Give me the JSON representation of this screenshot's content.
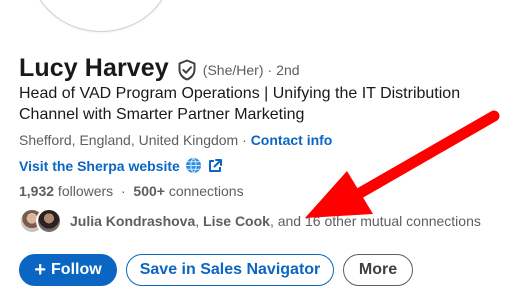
{
  "profile": {
    "name": "Lucy Harvey",
    "pronouns": "(She/Her)",
    "separator": "·",
    "degree": "2nd",
    "headline": "Head of VAD Program Operations | Unifying the IT Distribution Channel with Smarter Partner Marketing",
    "location": "Shefford, England, United Kingdom",
    "location_separator": " · ",
    "contact_link": "Contact info",
    "website_link": "Visit the Sherpa website",
    "followers_count": "1,932",
    "followers_label": " followers",
    "follow_sep": "  ·  ",
    "connections_count": "500+",
    "connections_label": " connections",
    "mutual_name_1": "Julia Kondrashova",
    "mutual_sep": ", ",
    "mutual_name_2": "Lise Cook",
    "mutual_rest": ", and 16 other mutual connections"
  },
  "actions": {
    "follow_plus": "+",
    "follow_label": "Follow",
    "sales_label": "Save in Sales Navigator",
    "more_label": "More"
  },
  "icons": {
    "verified": "shield-check-icon",
    "globe": "globe-icon",
    "external": "external-link-icon"
  },
  "colors": {
    "link_blue": "#0a66c2",
    "annotation_red": "#ff0000",
    "muted_text": "#5e5e5e"
  }
}
